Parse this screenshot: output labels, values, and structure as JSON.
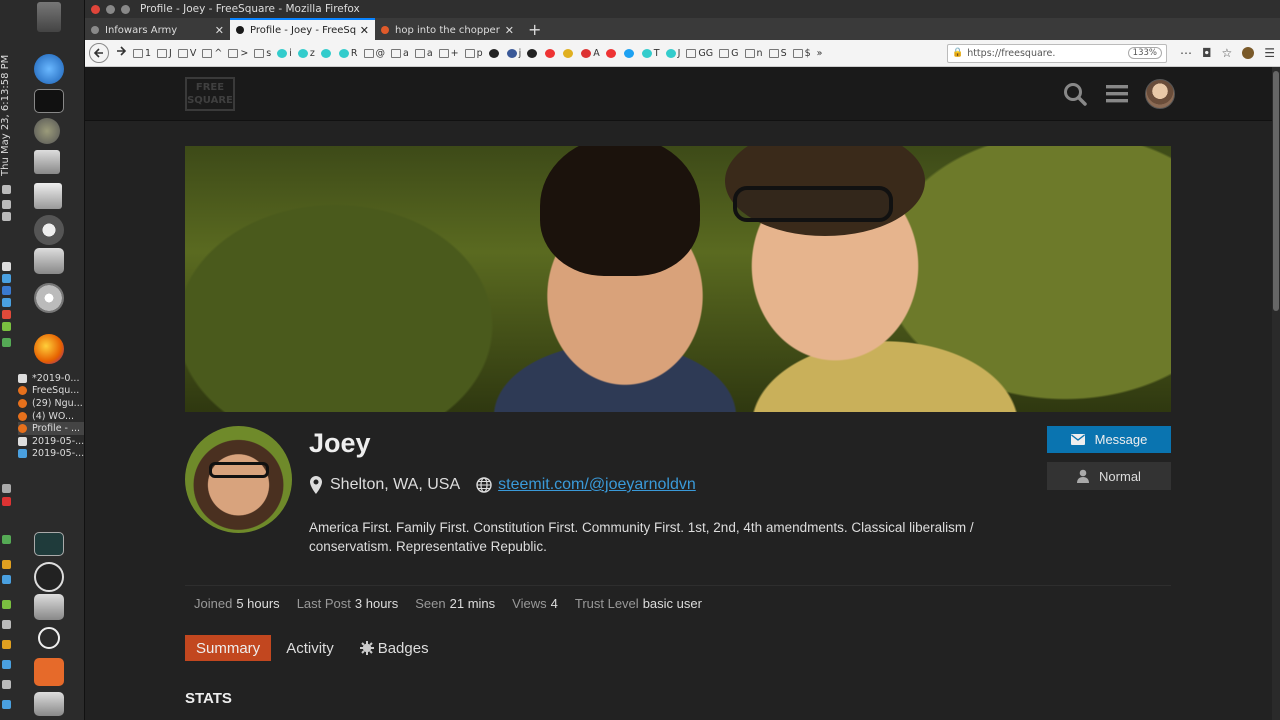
{
  "desktop": {
    "clock": "Thu May 23,  6:13:58 PM",
    "windows": [
      {
        "label": "*2019-0...",
        "color": "#dddddd"
      },
      {
        "label": "FreeSqu...",
        "color": "#e6701c"
      },
      {
        "label": "(29) Ngu...",
        "color": "#e6701c"
      },
      {
        "label": "(4) WO...",
        "color": "#e6701c"
      },
      {
        "label": "Profile - ...",
        "color": "#e6701c"
      },
      {
        "label": "2019-05-...",
        "color": "#dddddd"
      },
      {
        "label": "2019-05-...",
        "color": "#4aa0e0"
      }
    ]
  },
  "browser": {
    "window_title": "Profile - Joey - FreeSquare - Mozilla Firefox",
    "tabs": [
      {
        "label": "Infowars Army",
        "active": false,
        "icon_color": "#8a8a8a"
      },
      {
        "label": "Profile - Joey - FreeSqua",
        "active": true,
        "icon_color": "#1a1a1a"
      },
      {
        "label": "hop into the chopper an",
        "active": false,
        "icon_color": "#e05a2a"
      }
    ],
    "new_tab": "+",
    "bookmarks": [
      "1",
      "J",
      "V",
      "^",
      ">",
      "s",
      "i",
      "z",
      "",
      "R",
      "@",
      "a",
      "a",
      "+",
      "p",
      "",
      "j",
      "",
      "",
      "",
      "A",
      "",
      "",
      "T",
      "J",
      "GG",
      "G",
      "n",
      "S",
      "$"
    ],
    "url": "https://freesquare.",
    "zoom": "133%"
  },
  "site": {
    "logo_line1": "FREE",
    "logo_line2": "SQUARE"
  },
  "profile": {
    "username": "Joey",
    "location": "Shelton, WA, USA",
    "website": "steemit.com/@joeyarnoldvn",
    "bio": "America First. Family First. Constitution First. Community First. 1st, 2nd, 4th amendments. Classical liberalism / conservatism. Representative Republic.",
    "message_label": "Message",
    "normal_label": "Normal",
    "info": [
      {
        "key": "Joined",
        "value": "5 hours"
      },
      {
        "key": "Last Post",
        "value": "3 hours"
      },
      {
        "key": "Seen",
        "value": "21 mins"
      },
      {
        "key": "Views",
        "value": "4"
      },
      {
        "key": "Trust Level",
        "value": "basic user"
      }
    ],
    "nav": {
      "summary": "Summary",
      "activity": "Activity",
      "badges": "Badges"
    },
    "stats_heading": "STATS"
  },
  "colors": {
    "accent": "#c2471f",
    "message_button": "#0a74b0",
    "link": "#3a9ad9"
  }
}
